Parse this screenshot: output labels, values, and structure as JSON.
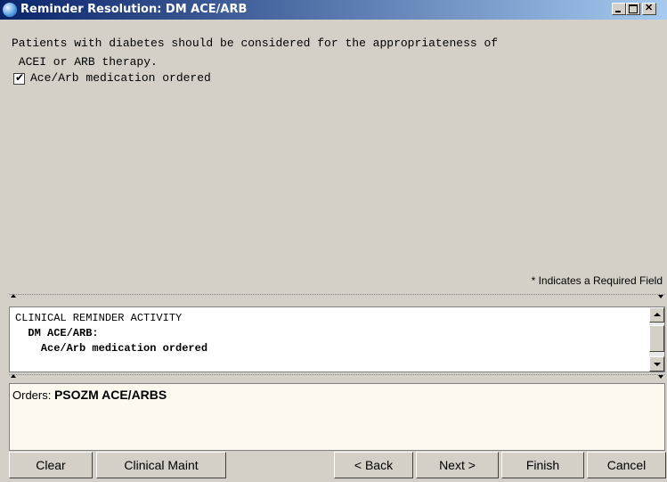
{
  "window": {
    "title": "Reminder Resolution: DM ACE/ARB",
    "controls": {
      "minimize_icon": "minimize-icon",
      "maximize_icon": "maximize-icon",
      "close_icon": "close-icon"
    },
    "accent_color": "#0a246a"
  },
  "main": {
    "description": "Patients with diabetes should be considered for the appropriateness of\n ACEI or ARB therapy.",
    "checkbox": {
      "label": "Ace/Arb medication ordered",
      "checked": true
    },
    "required_note": "* Indicates a Required Field"
  },
  "activity": {
    "heading": "CLINICAL REMINDER ACTIVITY",
    "reminder_name": "  DM ACE/ARB:",
    "item": "    Ace/Arb medication ordered"
  },
  "orders": {
    "label": "Orders: ",
    "value": "PSOZM ACE/ARBS"
  },
  "buttons": {
    "clear": "Clear",
    "clinical_maint": "Clinical Maint",
    "back": "< Back",
    "next": "Next >",
    "finish": "Finish",
    "cancel": "Cancel"
  }
}
